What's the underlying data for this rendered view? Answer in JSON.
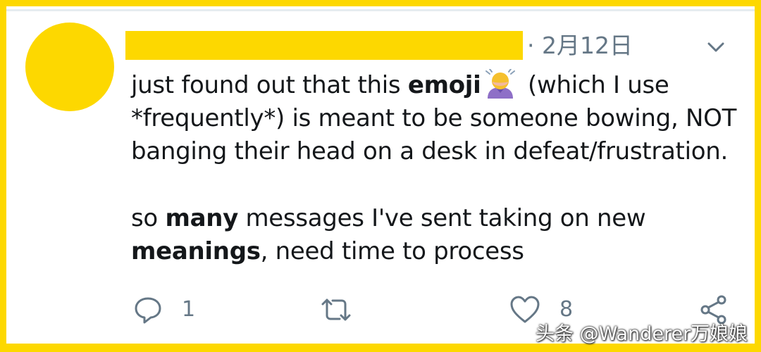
{
  "tweet": {
    "date": "· 2月12日",
    "line1_a": "just found out that this ",
    "line1_bold": "emoji",
    "line1_b": " (which I use",
    "line2": "*frequently*) is meant to be someone bowing, NOT",
    "line3": "banging their head on a desk in defeat/frustration.",
    "line4_a": "so ",
    "line4_bold": "many",
    "line4_b": " messages I've sent taking on new",
    "line5_bold": "meanings",
    "line5_b": ", need time to process",
    "emoji_icon": "person-bowing-emoji"
  },
  "actions": {
    "reply_count": "1",
    "like_count": "8"
  },
  "watermark": "头条 @Wanderer万娘娘",
  "colors": {
    "highlight": "#FDD800",
    "text": "#14171a",
    "muted": "#657786"
  }
}
